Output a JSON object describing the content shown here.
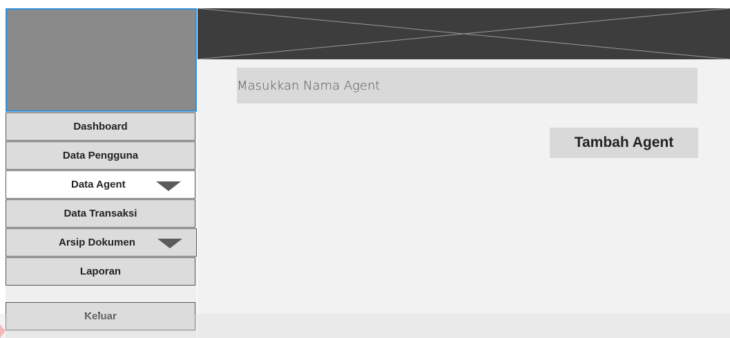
{
  "header": {
    "logo_alt": "logo-placeholder",
    "banner": "image-placeholder"
  },
  "main": {
    "search_placeholder": "Masukkan Nama Agent",
    "add_button_label": "Tambah Agent"
  },
  "sidebar": {
    "items": [
      {
        "label": "Dashboard",
        "active": false,
        "has_dropdown": false
      },
      {
        "label": "Data Pengguna",
        "active": false,
        "has_dropdown": false
      },
      {
        "label": "Data Agent",
        "active": true,
        "has_dropdown": true,
        "icon": "chevron-down-icon"
      },
      {
        "label": "Data Transaksi",
        "active": false,
        "has_dropdown": false
      },
      {
        "label": "Arsip Dokumen",
        "active": false,
        "has_dropdown": true,
        "icon": "chevron-down-icon"
      },
      {
        "label": "Laporan",
        "active": false,
        "has_dropdown": false
      }
    ],
    "logout_label": "Keluar"
  },
  "colors": {
    "header_bg": "#3d3d3d",
    "logo_bg": "#8a8a8a",
    "logo_border": "#2f8fd9",
    "content_bg": "#f2f2f2",
    "control_bg": "#d9d9d9",
    "active_item_bg": "#ffffff"
  }
}
